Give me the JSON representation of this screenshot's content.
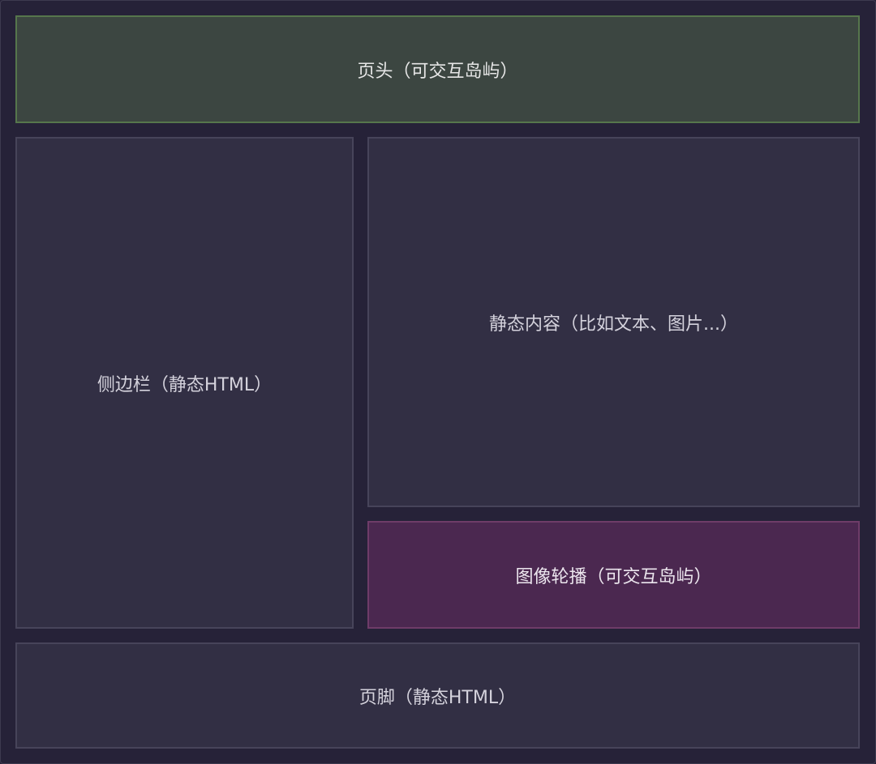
{
  "regions": {
    "header": {
      "label": "页头（可交互岛屿）",
      "kind": "interactive-island",
      "color": "#3c4641"
    },
    "sidebar": {
      "label": "侧边栏（静态HTML）",
      "kind": "static",
      "color": "#322f44"
    },
    "content": {
      "label": "静态内容（比如文本、图片...）",
      "kind": "static",
      "color": "#322f44"
    },
    "carousel": {
      "label": "图像轮播（可交互岛屿）",
      "kind": "interactive-island",
      "color": "#4b2850"
    },
    "footer": {
      "label": "页脚（静态HTML）",
      "kind": "static",
      "color": "#322f44"
    }
  }
}
